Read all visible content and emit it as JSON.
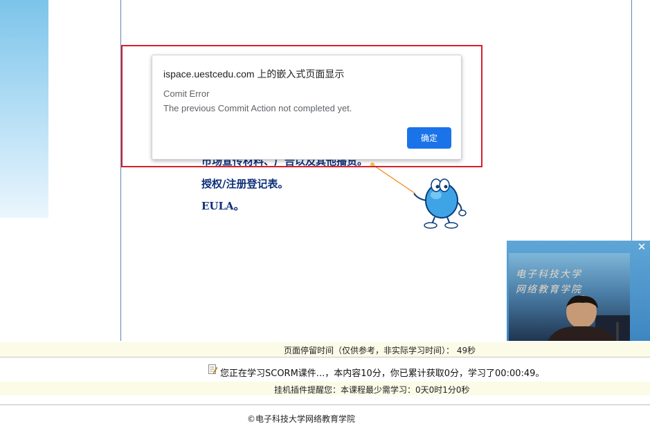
{
  "dialog": {
    "title": "ispace.uestcedu.com 上的嵌入式页面显示",
    "message_line1": "Comit Error",
    "message_line2": "The previous Commit Action not completed yet.",
    "ok_label": "确定",
    "accent_color": "#1a73e8",
    "highlight_color": "#d81e2a"
  },
  "course_content": {
    "lines": [
      "市场宣传材料、广告以及其他播货。",
      "授权/注册登记表。",
      "EULA。"
    ]
  },
  "video": {
    "caption_line1": "电子科技大学",
    "caption_line2": "网络教育学院",
    "close_icon": "close-icon"
  },
  "status": {
    "stay_time": "页面停留时间（仅供参考，非实际学习时间）： 49秒",
    "learning_text": "您正在学习SCORM课件...，本内容10分，你已累计获取0分，学习了00:00:49。",
    "learning_icon": "document-edit-icon",
    "idle_reminder": "挂机插件提醒您：本课程最少需学习：0天0时1分0秒"
  },
  "footer": {
    "copyright": "©电子科技大学网络教育学院"
  }
}
